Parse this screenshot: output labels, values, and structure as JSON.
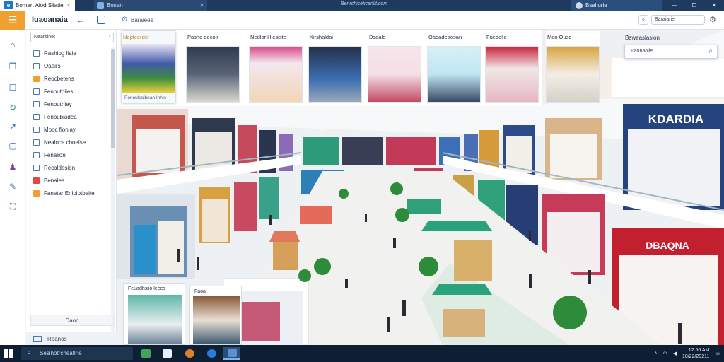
{
  "browser": {
    "tabs": [
      {
        "title": "Bomart Aiod Sliatie"
      },
      {
        "title": "Bosen"
      },
      {
        "title": "Bsaliurie"
      }
    ],
    "address": "Benrchiseticanlit.com"
  },
  "toolbar": {
    "app_title": "Iuaoanaia",
    "search_label": "Baraiees",
    "right_field": "Baraiarie",
    "right_search_icon": "search-icon"
  },
  "sidebar": {
    "search_placeholder": "Nearsinet",
    "items": [
      {
        "label": "Rashiog liaie"
      },
      {
        "label": "Oaeirs"
      },
      {
        "label": "Reocbetens"
      },
      {
        "label": "Fenbuthiies"
      },
      {
        "label": "Fenbuthiey"
      },
      {
        "label": "Fenbubiadea"
      },
      {
        "label": "Mooc fionlay"
      },
      {
        "label": "Nealoce choelse"
      },
      {
        "label": "Fenalion"
      },
      {
        "label": "Recaldesion"
      },
      {
        "label": "Benalea"
      },
      {
        "label": "Fanetar Enipiotbaite"
      }
    ],
    "footer_label": "Daon",
    "footer2_label": "Reanos"
  },
  "categories": [
    {
      "label": "Nepteerdel",
      "sub": "Ponoulsaibean Inhin"
    },
    {
      "label": "Pasho decoir"
    },
    {
      "label": "Nedlor Hlesiste"
    },
    {
      "label": "Kirshaldai"
    },
    {
      "label": "Dsaale"
    },
    {
      "label": "Oaoadeaosan"
    },
    {
      "label": "Fuedelle"
    },
    {
      "label": "Mao Ouse"
    }
  ],
  "right_panel": {
    "label": "Bsweaslasion",
    "search_placeholder": "Paonaolie"
  },
  "store_signs": {
    "big_right": "KDARDIA",
    "lower_right": "DBAQNA"
  },
  "bottom_cards": [
    {
      "label": "Feuadhsiio leees"
    },
    {
      "label": "Faoa"
    }
  ],
  "taskbar": {
    "search_placeholder": "Sesihotrcheatlrie",
    "time": "12:56 AM",
    "date": "10/22/20211"
  },
  "colors": {
    "accent_orange": "#f0a030",
    "nav_dark": "#1f3a5f",
    "link_blue": "#2b6cb0"
  }
}
